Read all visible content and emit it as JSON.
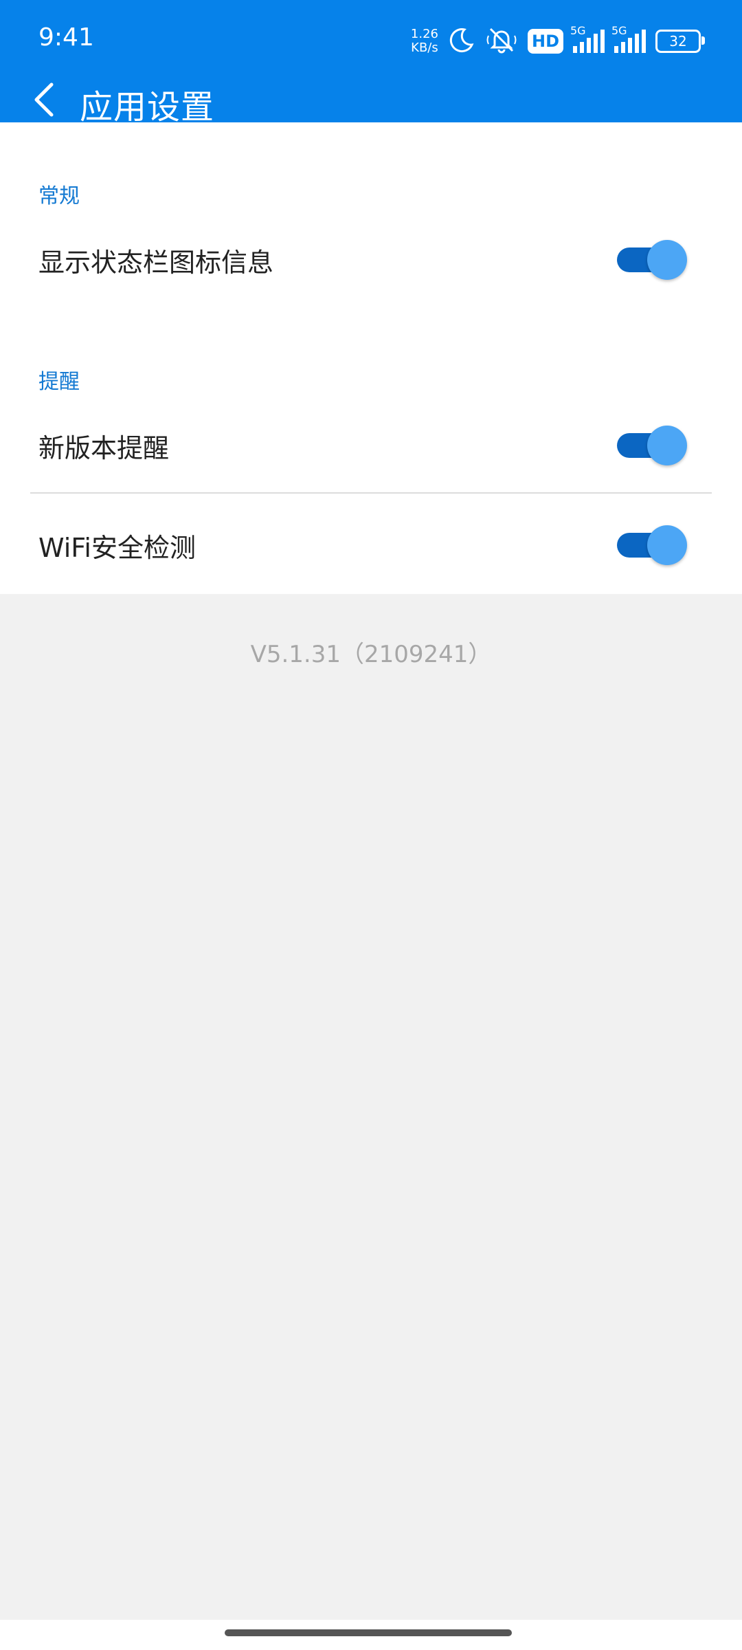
{
  "status_bar": {
    "time": "9:41",
    "net_speed_value": "1.26",
    "net_speed_unit": "KB/s",
    "hd_label": "HD",
    "network1": "5G",
    "network2": "5G",
    "battery": "32",
    "icons": [
      "moon-icon",
      "bell-off-icon",
      "hd-icon",
      "signal-icon",
      "signal-icon",
      "battery-icon"
    ]
  },
  "header": {
    "title": "应用设置",
    "back_icon": "chevron-left-icon"
  },
  "sections": [
    {
      "header": "常规",
      "items": [
        {
          "label": "显示状态栏图标信息",
          "enabled": true
        }
      ]
    },
    {
      "header": "提醒",
      "items": [
        {
          "label": "新版本提醒",
          "enabled": true
        },
        {
          "label": "WiFi安全检测",
          "enabled": true
        }
      ]
    }
  ],
  "version": "V5.1.31（2109241）",
  "colors": {
    "appbar": "#0682EA",
    "accent_text": "#1379D2",
    "toggle_track": "#0B66C2",
    "toggle_thumb": "#4CA6F5",
    "background": "#F1F1F1"
  }
}
